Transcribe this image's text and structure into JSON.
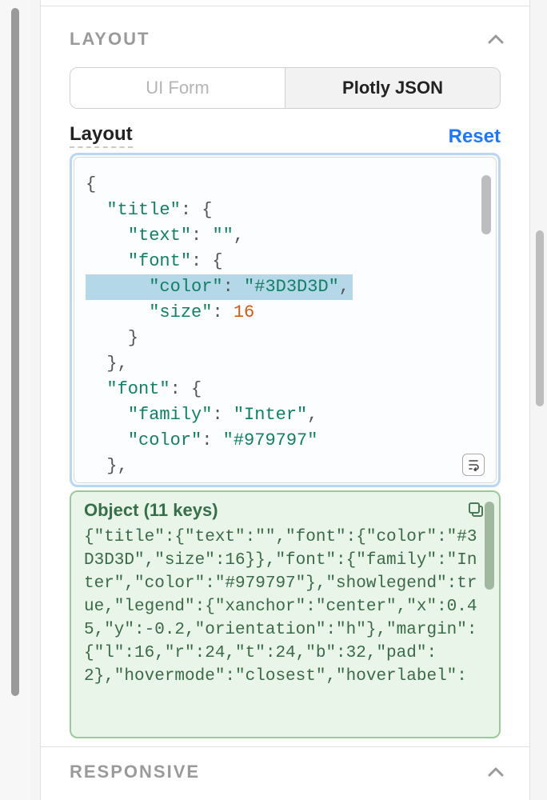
{
  "section": {
    "title": "LAYOUT",
    "tabs": {
      "uiform": "UI Form",
      "json": "Plotly JSON"
    },
    "field_label": "Layout",
    "reset": "Reset"
  },
  "code": {
    "brace_open": "{",
    "title_key": "\"title\"",
    "text_key": "\"text\"",
    "text_val": "\"\"",
    "font_key": "\"font\"",
    "color_key": "\"color\"",
    "color_val1": "\"#3D3D3D\"",
    "size_key": "\"size\"",
    "size_val": "16",
    "family_key": "\"family\"",
    "family_val": "\"Inter\"",
    "color_val2": "\"#979797\"",
    "brace_close": "}",
    "comma": ",",
    "colon_brace": ": {",
    "colon": ": "
  },
  "preview": {
    "title": "Object (11 keys)",
    "body": "{\"title\":{\"text\":\"\",\"font\":{\"color\":\"#3D3D3D\",\"size\":16}},\"font\":{\"family\":\"Inter\",\"color\":\"#979797\"},\"showlegend\":true,\"legend\":{\"xanchor\":\"center\",\"x\":0.45,\"y\":-0.2,\"orientation\":\"h\"},\"margin\":{\"l\":16,\"r\":24,\"t\":24,\"b\":32,\"pad\":2},\"hovermode\":\"closest\",\"hoverlabel\":"
  },
  "responsive": {
    "title": "RESPONSIVE"
  },
  "chart_data": {
    "type": "table",
    "title": "Plotly layout JSON (editor content)",
    "object_keys": 11,
    "data": {
      "title": {
        "text": "",
        "font": {
          "color": "#3D3D3D",
          "size": 16
        }
      },
      "font": {
        "family": "Inter",
        "color": "#979797"
      },
      "showlegend": true,
      "legend": {
        "xanchor": "center",
        "x": 0.45,
        "y": -0.2,
        "orientation": "h"
      },
      "margin": {
        "l": 16,
        "r": 24,
        "t": 24,
        "b": 32,
        "pad": 2
      },
      "hovermode": "closest"
    }
  }
}
